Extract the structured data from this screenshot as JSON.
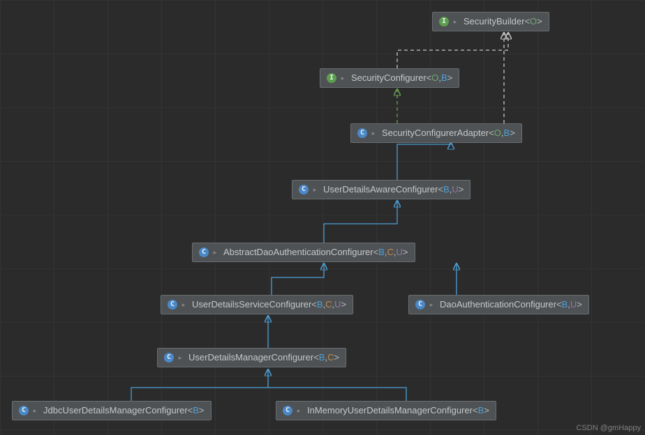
{
  "watermark": "CSDN @gmHappy",
  "nodes": {
    "securityBuilder": {
      "icon": "I",
      "iconClass": "icon-interface",
      "name": "SecurityBuilder",
      "params": [
        {
          "t": "O",
          "cls": "tp-O"
        }
      ]
    },
    "securityConfigurer": {
      "icon": "I",
      "iconClass": "icon-interface",
      "name": "SecurityConfigurer",
      "params": [
        {
          "t": "O",
          "cls": "tp-O"
        },
        {
          "t": "B",
          "cls": "tp-B"
        }
      ]
    },
    "securityConfigurerAdapter": {
      "icon": "C",
      "iconClass": "icon-abstract",
      "name": "SecurityConfigurerAdapter",
      "params": [
        {
          "t": "O",
          "cls": "tp-O"
        },
        {
          "t": "B",
          "cls": "tp-B"
        }
      ]
    },
    "userDetailsAwareConfigurer": {
      "icon": "C",
      "iconClass": "icon-abstract",
      "name": "UserDetailsAwareConfigurer",
      "params": [
        {
          "t": "B",
          "cls": "tp-B"
        },
        {
          "t": "U",
          "cls": "tp-U"
        }
      ]
    },
    "abstractDaoAuthConfigurer": {
      "icon": "C",
      "iconClass": "icon-abstract",
      "name": "AbstractDaoAuthenticationConfigurer",
      "params": [
        {
          "t": "B",
          "cls": "tp-B"
        },
        {
          "t": "C",
          "cls": "tp-C"
        },
        {
          "t": "U",
          "cls": "tp-U"
        }
      ]
    },
    "userDetailsServiceConfigurer": {
      "icon": "C",
      "iconClass": "icon-class",
      "name": "UserDetailsServiceConfigurer",
      "params": [
        {
          "t": "B",
          "cls": "tp-B"
        },
        {
          "t": "C",
          "cls": "tp-C"
        },
        {
          "t": "U",
          "cls": "tp-U"
        }
      ]
    },
    "daoAuthConfigurer": {
      "icon": "C",
      "iconClass": "icon-class",
      "name": "DaoAuthenticationConfigurer",
      "params": [
        {
          "t": "B",
          "cls": "tp-B"
        },
        {
          "t": "U",
          "cls": "tp-U"
        }
      ]
    },
    "userDetailsManagerConfigurer": {
      "icon": "C",
      "iconClass": "icon-class",
      "name": "UserDetailsManagerConfigurer",
      "params": [
        {
          "t": "B",
          "cls": "tp-B"
        },
        {
          "t": "C",
          "cls": "tp-C"
        }
      ]
    },
    "jdbcConfigurer": {
      "icon": "C",
      "iconClass": "icon-class",
      "name": "JdbcUserDetailsManagerConfigurer",
      "params": [
        {
          "t": "B",
          "cls": "tp-B"
        }
      ]
    },
    "inMemoryConfigurer": {
      "icon": "C",
      "iconClass": "icon-class",
      "name": "InMemoryUserDetailsManagerConfigurer",
      "params": [
        {
          "t": "B",
          "cls": "tp-B"
        }
      ]
    }
  }
}
